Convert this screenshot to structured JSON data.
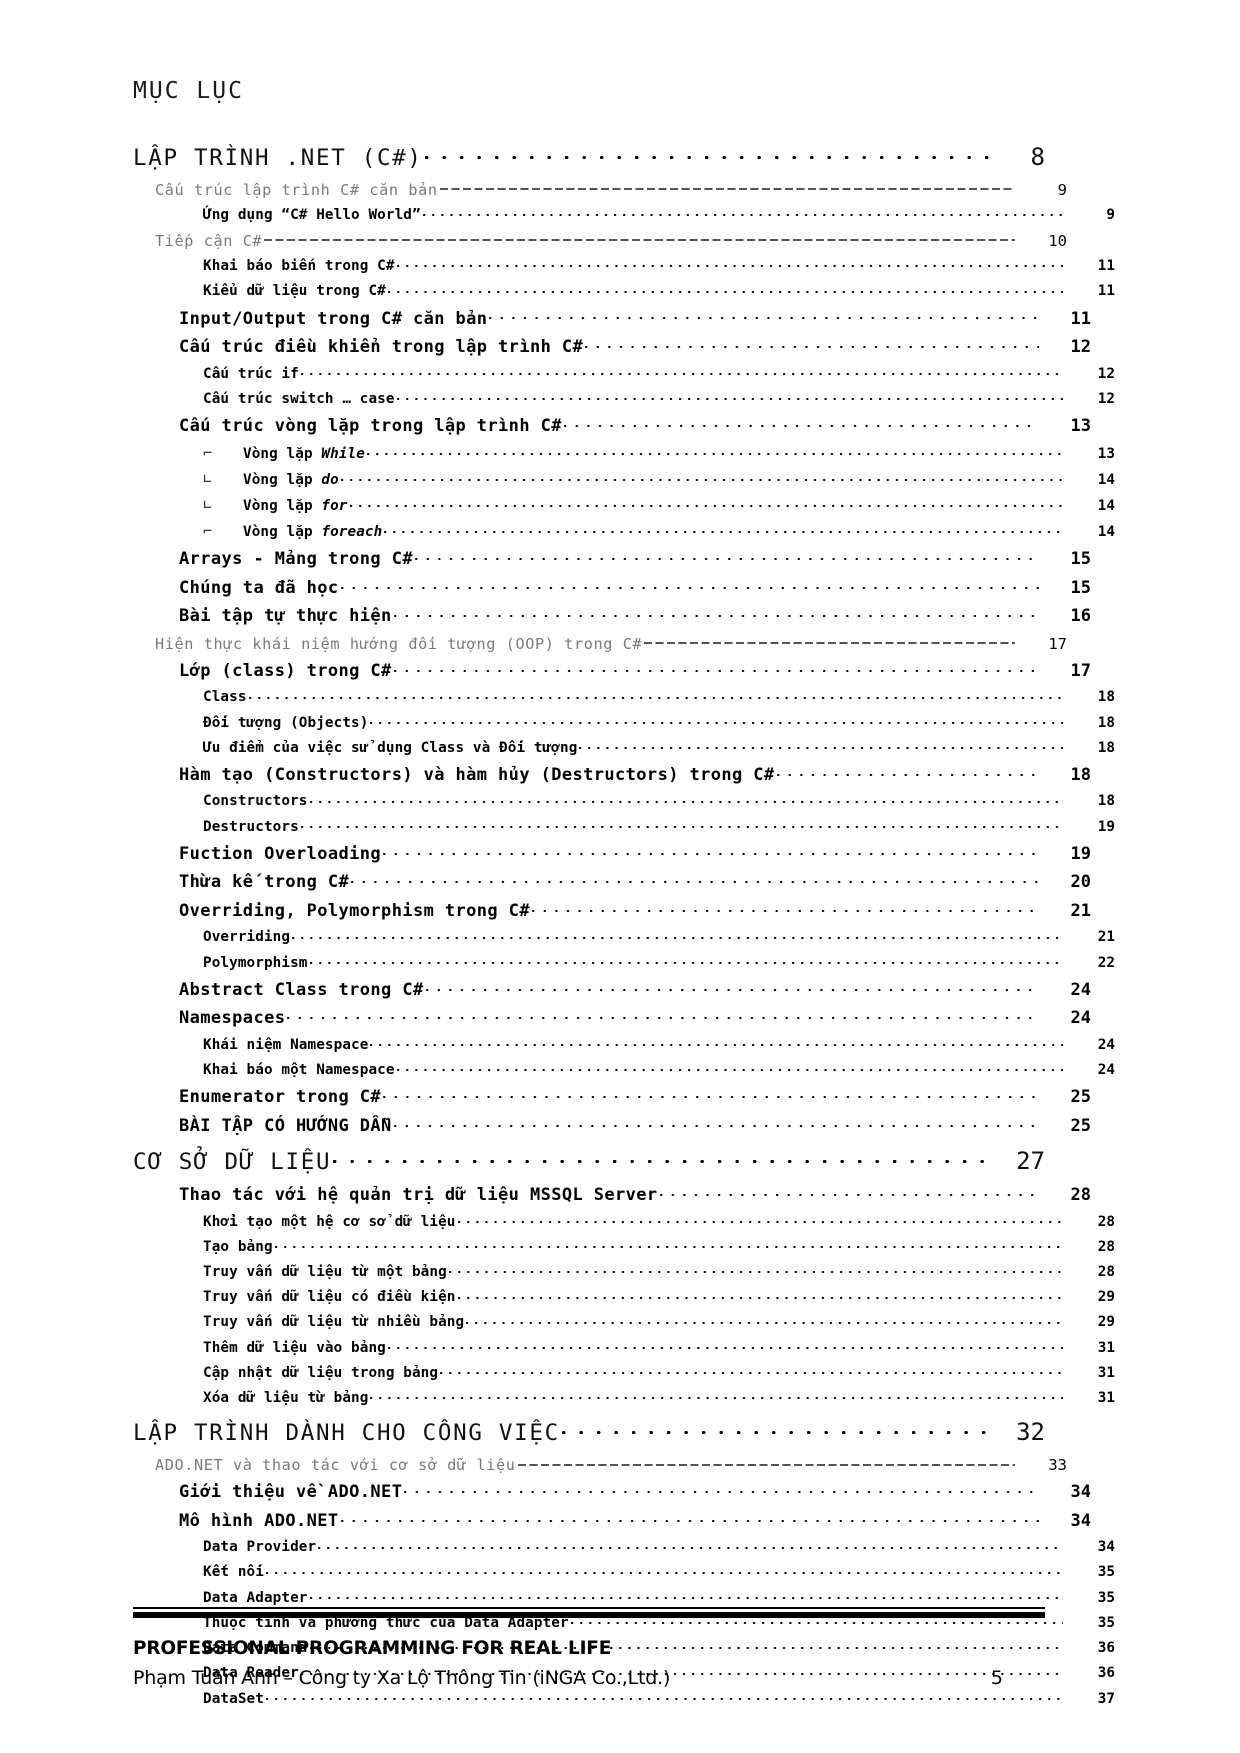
{
  "document": {
    "toc_heading": "MỤC LỤC"
  },
  "toc": {
    "entries": [
      {
        "level": 1,
        "indent": 0,
        "label": "LẬP TRÌNH .NET (C#)",
        "page": "8",
        "leader": "dot-lg"
      },
      {
        "level": 2,
        "indent": 1,
        "label": "Cấu trúc lập trình C# căn bản",
        "page": "9",
        "leader": "dash"
      },
      {
        "level": 4,
        "indent": 3,
        "label": "Ứng dụng “C# Hello World”",
        "page": "9",
        "leader": "dot-sm"
      },
      {
        "level": 2,
        "indent": 1,
        "label": "Tiếp cận C#",
        "page": "10",
        "leader": "dash"
      },
      {
        "level": 4,
        "indent": 3,
        "label": "Khai báo biến trong C#",
        "page": "11",
        "leader": "dot-sm"
      },
      {
        "level": 4,
        "indent": 3,
        "label": "Kiểu dữ liệu trong C#",
        "page": "11",
        "leader": "dot-sm"
      },
      {
        "level": 3,
        "indent": 2,
        "label": "Input/Output trong C# căn bản",
        "page": "11",
        "leader": "dot"
      },
      {
        "level": 3,
        "indent": 2,
        "label": "Cấu trúc điều khiển trong lập trình C#",
        "page": "12",
        "leader": "dot"
      },
      {
        "level": 4,
        "indent": 3,
        "label": "Cấu trúc if",
        "page": "12",
        "leader": "dot-sm"
      },
      {
        "level": 4,
        "indent": 3,
        "label": "Cấu trúc switch … case",
        "page": "12",
        "leader": "dot-sm"
      },
      {
        "level": 3,
        "indent": 2,
        "label": "Cấu trúc vòng lặp trong lập trình C#",
        "page": "13",
        "leader": "dot"
      },
      {
        "level": 4,
        "indent": 3,
        "bullet": "⌐",
        "label": "Vòng lặp ",
        "italic": "While",
        "page": "13",
        "leader": "dot-sm"
      },
      {
        "level": 4,
        "indent": 3,
        "bullet": "∟",
        "label": "Vòng lặp ",
        "italic": "do",
        "page": "14",
        "leader": "dot-sm"
      },
      {
        "level": 4,
        "indent": 3,
        "bullet": "∟",
        "label": "Vòng lặp ",
        "italic": "for",
        "page": "14",
        "leader": "dot-sm"
      },
      {
        "level": 4,
        "indent": 3,
        "bullet": "⌐",
        "label": "Vòng lặp ",
        "italic": "foreach",
        "page": "14",
        "leader": "dot-sm"
      },
      {
        "level": 3,
        "indent": 2,
        "label": "Arrays - Mảng trong C#",
        "page": "15",
        "leader": "dot"
      },
      {
        "level": 3,
        "indent": 2,
        "label": "Chúng ta đã học",
        "page": "15",
        "leader": "dot"
      },
      {
        "level": 3,
        "indent": 2,
        "label": "Bài tập tự thực hiện",
        "page": "16",
        "leader": "dot"
      },
      {
        "level": 2,
        "indent": 1,
        "label": "Hiện thực khái niệm hướng đối tượng (OOP) trong C#",
        "page": "17",
        "leader": "dash"
      },
      {
        "level": 3,
        "indent": 2,
        "label": "Lớp (class) trong C#",
        "page": "17",
        "leader": "dot"
      },
      {
        "level": 4,
        "indent": 3,
        "label": "Class",
        "page": "18",
        "leader": "dot-sm"
      },
      {
        "level": 4,
        "indent": 3,
        "label": "Đối tượng (Objects)",
        "page": "18",
        "leader": "dot-sm"
      },
      {
        "level": 4,
        "indent": 3,
        "label": "Ưu điểm của việc sử dụng Class và Đối tượng",
        "page": "18",
        "leader": "dot-sm"
      },
      {
        "level": 3,
        "indent": 2,
        "label": "Hàm tạo (Constructors) và hàm hủy (Destructors) trong C#",
        "page": "18",
        "leader": "dot"
      },
      {
        "level": 4,
        "indent": 3,
        "label": "Constructors",
        "page": "18",
        "leader": "dot-sm"
      },
      {
        "level": 4,
        "indent": 3,
        "label": "Destructors",
        "page": "19",
        "leader": "dot-sm"
      },
      {
        "level": 3,
        "indent": 2,
        "label": "Fuction Overloading",
        "page": "19",
        "leader": "dot"
      },
      {
        "level": 3,
        "indent": 2,
        "label": "Thừa kế trong C#",
        "page": "20",
        "leader": "dot"
      },
      {
        "level": 3,
        "indent": 2,
        "label": "Overriding, Polymorphism trong C#",
        "page": "21",
        "leader": "dot"
      },
      {
        "level": 4,
        "indent": 3,
        "label": "Overriding",
        "page": "21",
        "leader": "dot-sm"
      },
      {
        "level": 4,
        "indent": 3,
        "label": "Polymorphism",
        "page": "22",
        "leader": "dot-sm"
      },
      {
        "level": 3,
        "indent": 2,
        "label": "Abstract Class trong C#",
        "page": "24",
        "leader": "dot"
      },
      {
        "level": 3,
        "indent": 2,
        "label": "Namespaces",
        "page": "24",
        "leader": "dot"
      },
      {
        "level": 4,
        "indent": 3,
        "label": "Khái niệm Namespace",
        "page": "24",
        "leader": "dot-sm"
      },
      {
        "level": 4,
        "indent": 3,
        "label": "Khai báo một Namespace",
        "page": "24",
        "leader": "dot-sm"
      },
      {
        "level": 3,
        "indent": 2,
        "label": "Enumerator trong C#",
        "page": "25",
        "leader": "dot"
      },
      {
        "level": 3,
        "indent": 2,
        "label": "BÀI TẬP CÓ HƯỚNG DẪN",
        "page": "25",
        "leader": "dot"
      },
      {
        "level": 1,
        "indent": 0,
        "label": "CƠ SỞ DỮ LIỆU",
        "page": "27",
        "leader": "dot-lg"
      },
      {
        "level": 3,
        "indent": 2,
        "label": "Thao tác với hệ quản trị dữ liệu MSSQL Server",
        "page": "28",
        "leader": "dot"
      },
      {
        "level": 4,
        "indent": 3,
        "label": "Khởi tạo một hệ cơ sở dữ liệu",
        "page": "28",
        "leader": "dot-sm"
      },
      {
        "level": 4,
        "indent": 3,
        "label": "Tạo bảng",
        "page": "28",
        "leader": "dot-sm"
      },
      {
        "level": 4,
        "indent": 3,
        "label": "Truy vấn dữ liệu từ một bảng",
        "page": "28",
        "leader": "dot-sm"
      },
      {
        "level": 4,
        "indent": 3,
        "label": "Truy vấn dữ liệu có điều kiện",
        "page": "29",
        "leader": "dot-sm"
      },
      {
        "level": 4,
        "indent": 3,
        "label": "Truy vấn dữ liệu từ nhiều bảng",
        "page": "29",
        "leader": "dot-sm"
      },
      {
        "level": 4,
        "indent": 3,
        "label": "Thêm dữ liệu vào bảng",
        "page": "31",
        "leader": "dot-sm"
      },
      {
        "level": 4,
        "indent": 3,
        "label": "Cập nhật dữ liệu trong bảng",
        "page": "31",
        "leader": "dot-sm"
      },
      {
        "level": 4,
        "indent": 3,
        "label": "Xóa dữ liệu từ bảng",
        "page": "31",
        "leader": "dot-sm"
      },
      {
        "level": 1,
        "indent": 0,
        "label": "LẬP TRÌNH DÀNH CHO CÔNG VIỆC",
        "page": "32",
        "leader": "dot-lg"
      },
      {
        "level": 2,
        "indent": 1,
        "label": "ADO.NET và thao tác với cơ sở dữ liệu",
        "page": "33",
        "leader": "dash"
      },
      {
        "level": 3,
        "indent": 2,
        "label": "Giới thiệu về ADO.NET",
        "page": "34",
        "leader": "dot"
      },
      {
        "level": 3,
        "indent": 2,
        "label": "Mô hình ADO.NET",
        "page": "34",
        "leader": "dot"
      },
      {
        "level": 4,
        "indent": 3,
        "label": "Data Provider",
        "page": "34",
        "leader": "dot-sm"
      },
      {
        "level": 4,
        "indent": 3,
        "label": "Kết nối",
        "page": "35",
        "leader": "dot-sm"
      },
      {
        "level": 4,
        "indent": 3,
        "label": "Data Adapter",
        "page": "35",
        "leader": "dot-sm"
      },
      {
        "level": 4,
        "indent": 3,
        "label": "Thuộc tính và phương thức của Data Adapter",
        "page": "35",
        "leader": "dot-sm"
      },
      {
        "level": 4,
        "indent": 3,
        "label": "Data Command",
        "page": "36",
        "leader": "dot-sm"
      },
      {
        "level": 4,
        "indent": 3,
        "label": "Data Reader",
        "page": "36",
        "leader": "dot-sm"
      },
      {
        "level": 4,
        "indent": 3,
        "label": "DataSet",
        "page": "37",
        "leader": "dot-sm"
      }
    ]
  },
  "footer": {
    "title": "PROFESSIONAL PROGRAMMING FOR REAL LIFE",
    "author": "Phạm Tuấn Anh – Công ty Xa Lộ Thông Tin (iNGA Co.,Ltd.)",
    "page_number": "5"
  }
}
